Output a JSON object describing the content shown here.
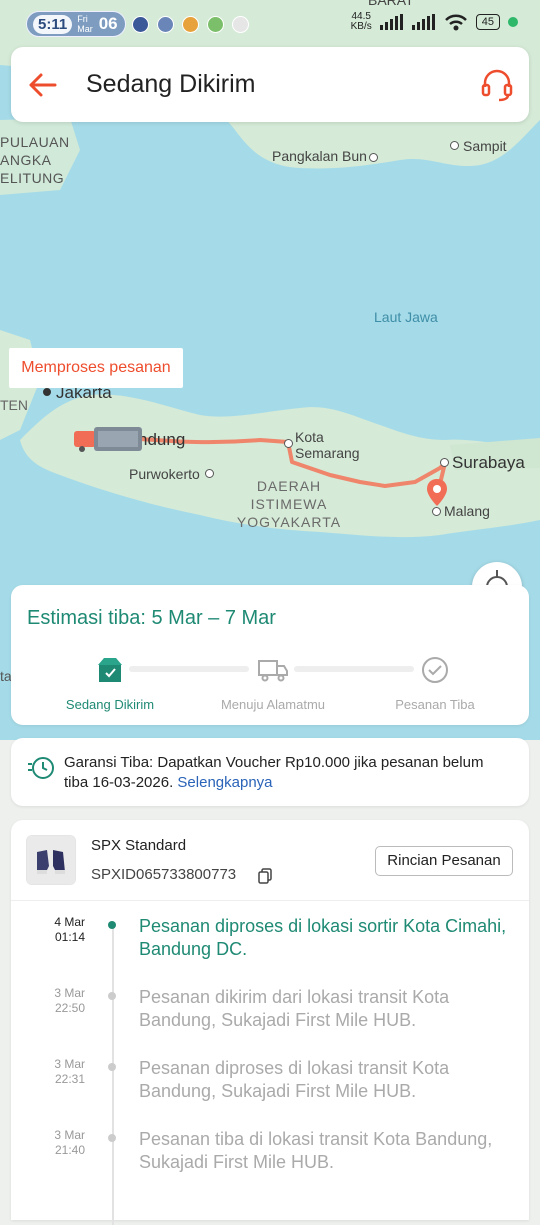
{
  "status_bar": {
    "time": "5:11",
    "day": "Fri",
    "month": "Mar",
    "date": "06",
    "net_speed": "44.5",
    "net_unit": "KB/s",
    "battery": "45"
  },
  "header": {
    "title": "Sedang Dikirim"
  },
  "map": {
    "callout": "Memproses pesanan",
    "labels": {
      "barat": "BARAT",
      "pulau_line1": "PULAUAN",
      "pulau_line2": "ANGKA",
      "pulau_line3": "ELITUNG",
      "pangkalan_bun": "Pangkalan Bun",
      "sampit": "Sampit",
      "laut_jawa": "Laut Jawa",
      "jakarta": "Jakarta",
      "ten": "TEN",
      "bandung": "ndung",
      "purwokerto": "Purwokerto",
      "kota_semarang_1": "Kota",
      "kota_semarang_2": "Semarang",
      "daerah_1": "DAERAH",
      "daerah_2": "ISTIMEWA",
      "daerah_3": "YOGYAKARTA",
      "surabaya": "Surabaya",
      "malang": "Malang",
      "ta": "ta"
    }
  },
  "eta": {
    "text": "Estimasi tiba: 5 Mar – 7 Mar",
    "steps": [
      {
        "label": "Sedang Dikirim"
      },
      {
        "label": "Menuju Alamatmu"
      },
      {
        "label": "Pesanan Tiba"
      }
    ]
  },
  "guarantee": {
    "text": "Garansi Tiba: Dapatkan Voucher Rp10.000 jika pesanan belum tiba 16-03-2026.",
    "link": "Selengkapnya"
  },
  "shipment": {
    "carrier": "SPX Standard",
    "tracking_number": "SPXID065733800773",
    "detail_button": "Rincian Pesanan"
  },
  "timeline": [
    {
      "date": "4 Mar",
      "time": "01:14",
      "text": "Pesanan diproses di lokasi sortir Kota Cimahi, Bandung DC."
    },
    {
      "date": "3 Mar",
      "time": "22:50",
      "text": "Pesanan dikirim dari lokasi transit Kota Bandung, Sukajadi First Mile HUB."
    },
    {
      "date": "3 Mar",
      "time": "22:31",
      "text": "Pesanan diproses di lokasi transit Kota Bandung, Sukajadi First Mile HUB."
    },
    {
      "date": "3 Mar",
      "time": "21:40",
      "text": "Pesanan tiba di lokasi transit Kota Bandung, Sukajadi First Mile HUB."
    }
  ],
  "colors": {
    "accent": "#ee4d2d",
    "success": "#1f8a74",
    "sea": "#a5dbe8",
    "land": "#d5ead7"
  }
}
